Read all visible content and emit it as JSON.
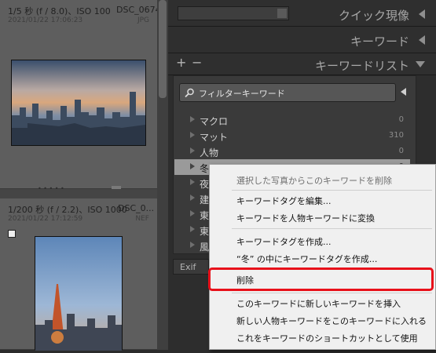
{
  "grid": {
    "photo1": {
      "exposure": "1/5 秒 (f / 8.0)、ISO 100",
      "filename": "DSC_0674...",
      "date": "2021/01/22 17:06:23",
      "filetype": "JPG"
    },
    "photo2": {
      "exposure": "1/200 秒 (f / 2.2)、ISO 1000",
      "filename": "DSC_0...",
      "date": "2021/01/22 17:12:59",
      "filetype": "NEF"
    },
    "dots": "• • • • •"
  },
  "right_panel": {
    "quick_develop": "クイック現像",
    "keywording": "キーワード",
    "keyword_list": "キーワードリスト",
    "plus": "+",
    "minus": "−",
    "filter_placeholder": "フィルターキーワード",
    "keywords": [
      {
        "label": "マクロ",
        "count": "0"
      },
      {
        "label": "マット",
        "count": "310"
      },
      {
        "label": "人物",
        "count": "0"
      },
      {
        "label": "冬",
        "count": "0"
      },
      {
        "label": "夜",
        "count": ""
      },
      {
        "label": "建",
        "count": ""
      },
      {
        "label": "東",
        "count": ""
      },
      {
        "label": "東",
        "count": ""
      },
      {
        "label": "風",
        "count": ""
      }
    ],
    "exif": "Exif"
  },
  "context_menu": {
    "items": [
      "選択した写真からこのキーワードを削除",
      "キーワードタグを編集...",
      "キーワードを人物キーワードに変換",
      "キーワードタグを作成...",
      "“冬” の中にキーワードタグを作成...",
      "削除",
      "このキーワードに新しいキーワードを挿入",
      "新しい人物キーワードをこのキーワードに入れる",
      "これをキーワードのショートカットとして使用"
    ]
  },
  "colors": {
    "highlight": "#e8101a",
    "menu_bg": "#f0f0f0"
  }
}
